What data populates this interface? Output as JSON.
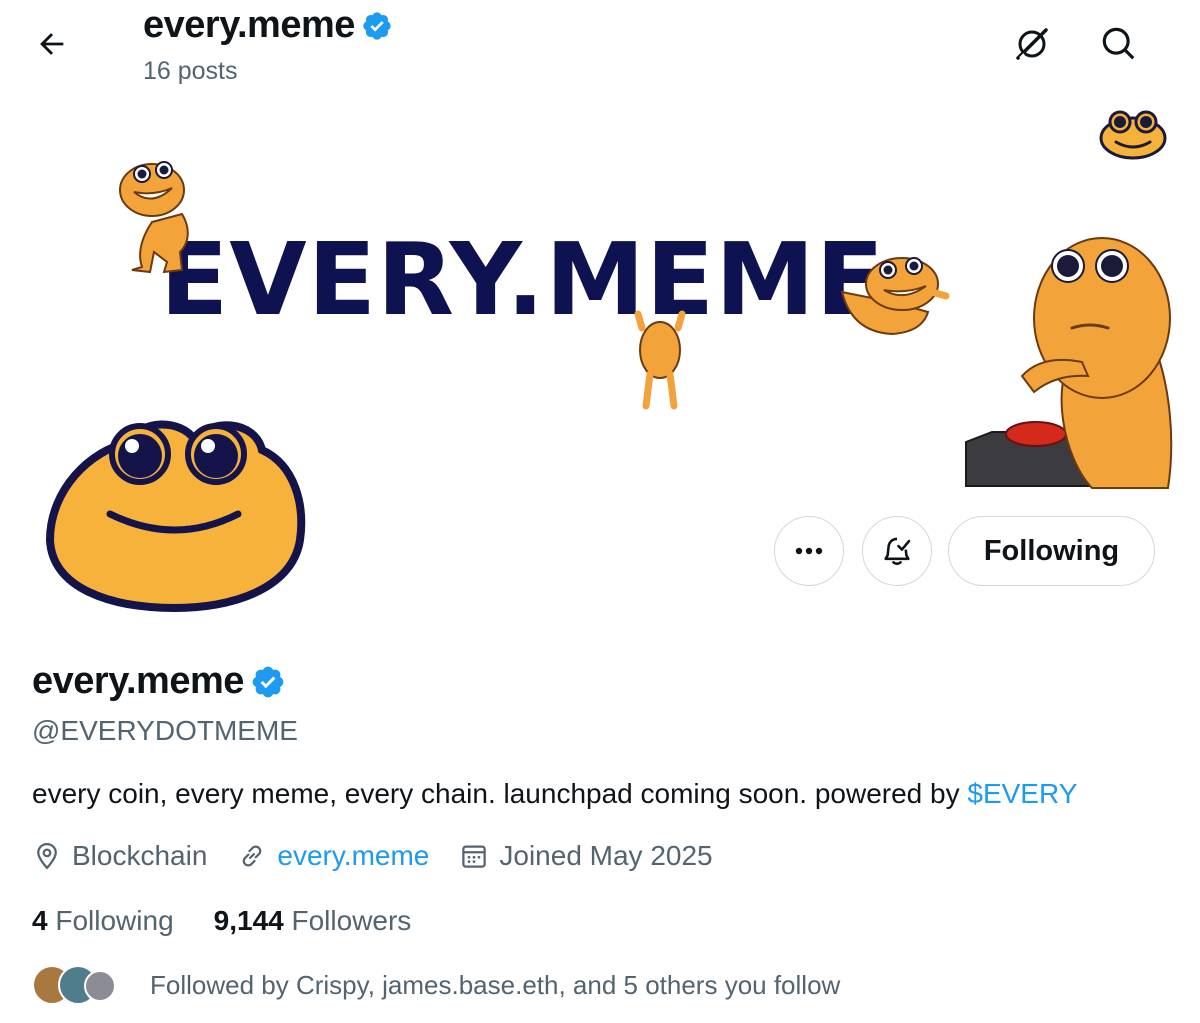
{
  "header": {
    "title": "every.meme",
    "posts_count": "16 posts"
  },
  "banner": {
    "text": "EVERY.MEME"
  },
  "actions": {
    "following_label": "Following"
  },
  "profile": {
    "name": "every.meme",
    "handle": "@EVERYDOTMEME",
    "bio_text": "every coin, every meme, every chain. launchpad coming soon. powered by ",
    "bio_tag": "$EVERY",
    "location": "Blockchain",
    "website": "every.meme",
    "joined": "Joined May 2025",
    "following_count": "4",
    "following_label": "Following",
    "followers_count": "9,144",
    "followers_label": "Followers",
    "followed_by": "Followed by Crispy, james.base.eth, and 5 others you follow"
  },
  "icons": {
    "back": "arrow-left-icon",
    "grok": "grok-icon",
    "search": "search-icon",
    "more": "more-icon",
    "notify": "bell-icon",
    "verified": "verified-badge-icon",
    "location": "location-pin-icon",
    "link": "link-icon",
    "calendar": "calendar-icon"
  },
  "colors": {
    "accent": "#1d9bf0",
    "text": "#0f1419",
    "muted": "#536471",
    "border": "#cfd9de",
    "banner_text": "#0f1250",
    "mascot": "#f2a33a"
  }
}
